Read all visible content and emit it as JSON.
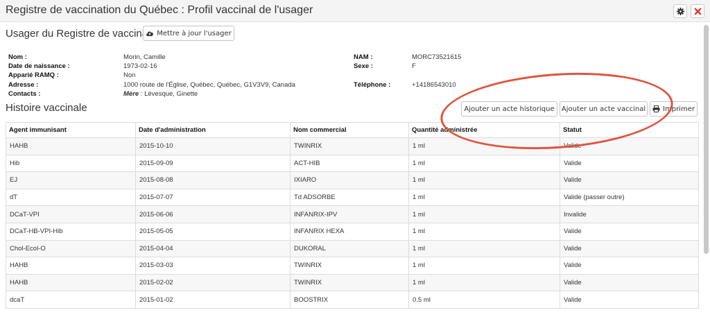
{
  "window": {
    "title": "Registre de vaccination du Québec : Profil vaccinal de l'usager",
    "gear_icon": "gear-icon",
    "close_icon": "close-icon"
  },
  "usager": {
    "section_title": "Usager du Registre de vaccination",
    "update_button": "Mettre à jour l'usager",
    "update_icon": "cloud-upload-icon",
    "labels": {
      "nom": "Nom :",
      "naissance": "Date de naissance :",
      "apparie": "Apparié RAMQ :",
      "adresse": "Adresse :",
      "contacts": "Contacts :",
      "nam": "NAM :",
      "sexe": "Sexe :",
      "telephone": "Téléphone :"
    },
    "values": {
      "nom": "Morin, Camille",
      "naissance": "1973-02-16",
      "apparie": "Non",
      "adresse": "1000 route de l'Église, Québec, Québec, G1V3V9, Canada",
      "contact_role": "Mère",
      "contact_name": " : Lévesque, Ginette",
      "nam": "MORC73521615",
      "sexe": "F",
      "telephone": "+14186543010"
    }
  },
  "histoire": {
    "section_title": "Histoire vaccinale",
    "add_historique_button": "Ajouter un acte historique",
    "add_vaccinal_button": "Ajouter un acte vaccinal",
    "print_button": "Imprimer",
    "print_icon": "printer-icon",
    "columns": [
      "Agent immunisant",
      "Date d'administration",
      "Nom commercial",
      "Quantité administrée",
      "Statut"
    ],
    "rows": [
      [
        "HAHB",
        "2015-10-10",
        "TWINRIX",
        "1 ml",
        "Valide"
      ],
      [
        "Hib",
        "2015-09-09",
        "ACT-HIB",
        "1 ml",
        "Valide"
      ],
      [
        "EJ",
        "2015-08-08",
        "IXIARO",
        "1 ml",
        "Valide"
      ],
      [
        "dT",
        "2015-07-07",
        "Td ADSORBE",
        "1 ml",
        "Valide (passer outre)"
      ],
      [
        "DCaT-VPI",
        "2015-06-06",
        "INFANRIX-IPV",
        "1 ml",
        "Invalide"
      ],
      [
        "DCaT-HB-VPI-Hib",
        "2015-05-05",
        "INFANRIX HEXA",
        "1 ml",
        "Valide"
      ],
      [
        "Chol-Ecol-O",
        "2015-04-04",
        "DUKORAL",
        "1 ml",
        "Valide"
      ],
      [
        "HAHB",
        "2015-03-03",
        "TWINRIX",
        "1 ml",
        "Valide"
      ],
      [
        "HAHB",
        "2015-02-02",
        "TWINRIX",
        "1 ml",
        "Valide"
      ],
      [
        "dcaT",
        "2015-01-02",
        "BOOSTRIX",
        "0.5 ml",
        "Valide"
      ]
    ]
  },
  "annotation_color": "#e0533c"
}
